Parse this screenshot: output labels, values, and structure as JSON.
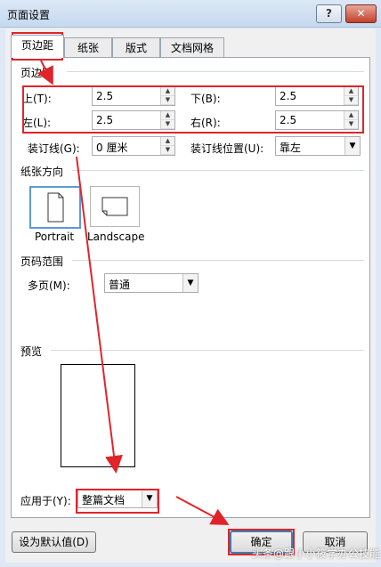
{
  "window": {
    "title": "页面设置",
    "help": "?",
    "close": "✕"
  },
  "tabs": [
    "页边距",
    "纸张",
    "版式",
    "文档网格"
  ],
  "margins": {
    "section": "页边距",
    "top": {
      "label": "上(T):",
      "value": "2.5"
    },
    "bottom": {
      "label": "下(B):",
      "value": "2.5"
    },
    "left": {
      "label": "左(L):",
      "value": "2.5"
    },
    "right": {
      "label": "右(R):",
      "value": "2.5"
    },
    "gutter": {
      "label": "装订线(G):",
      "value": "0 厘米"
    },
    "gutter_pos": {
      "label": "装订线位置(U):",
      "value": "靠左"
    }
  },
  "orientation": {
    "section": "纸张方向",
    "portrait": "Portrait",
    "landscape": "Landscape"
  },
  "pages": {
    "section": "页码范围",
    "label": "多页(M):",
    "value": "普通"
  },
  "preview": {
    "section": "预览"
  },
  "apply": {
    "label": "应用于(Y):",
    "value": "整篇文档"
  },
  "buttons": {
    "set_default": "设为默认值(D)",
    "ok": "确定",
    "cancel": "取消"
  },
  "watermark": "头条@跟小小筱学办公技能",
  "colors": {
    "highlight": "#e0242a",
    "selection": "#5b9bd5"
  }
}
